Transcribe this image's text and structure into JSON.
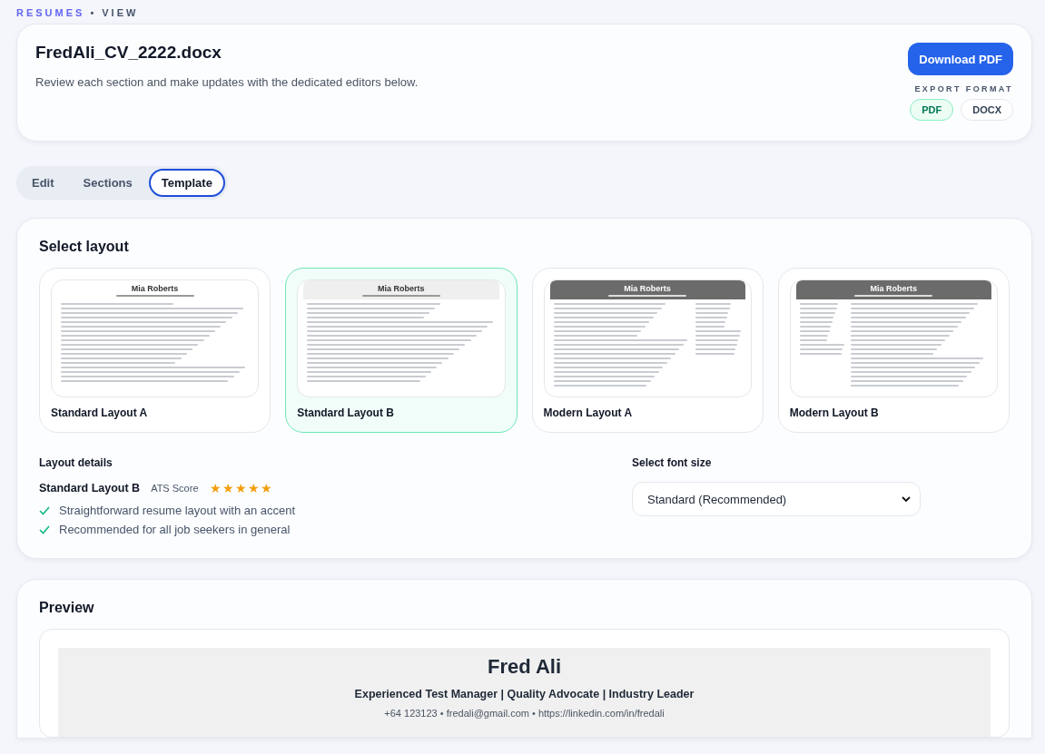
{
  "breadcrumb": {
    "section": "RESUMES",
    "separator": "•",
    "page": "VIEW"
  },
  "header": {
    "title": "FredAli_CV_2222.docx",
    "subtitle": "Review each section and make updates with the dedicated editors below.",
    "download_button": "Download PDF",
    "export_label": "EXPORT FORMAT",
    "formats": [
      {
        "label": "PDF",
        "selected": true
      },
      {
        "label": "DOCX",
        "selected": false
      }
    ]
  },
  "tabs": [
    {
      "label": "Edit",
      "selected": false
    },
    {
      "label": "Sections",
      "selected": false
    },
    {
      "label": "Template",
      "selected": true
    }
  ],
  "select_layout": {
    "title": "Select layout",
    "layouts": [
      {
        "name": "Standard Layout A",
        "kind": "plain",
        "thumb_name": "Mia Roberts",
        "selected": false
      },
      {
        "name": "Standard Layout B",
        "kind": "banded",
        "thumb_name": "Mia Roberts",
        "selected": true
      },
      {
        "name": "Modern Layout A",
        "kind": "sidebar-right",
        "thumb_name": "Mia Roberts",
        "selected": false
      },
      {
        "name": "Modern Layout B",
        "kind": "sidebar-left",
        "thumb_name": "Mia Roberts",
        "selected": false
      }
    ]
  },
  "layout_details": {
    "title": "Layout details",
    "layout_name": "Standard Layout B",
    "score_label": "ATS Score",
    "stars": 5,
    "features": [
      "Straightforward resume layout with an accent",
      "Recommended for all job seekers in general"
    ]
  },
  "font_size": {
    "title": "Select font size",
    "value": "Standard (Recommended)"
  },
  "preview": {
    "title": "Preview",
    "name": "Fred Ali",
    "headline": "Experienced Test Manager | Quality Advocate | Industry Leader",
    "contact": "+64 123123 • fredali@gmail.com • https://linkedin.com/in/fredali"
  }
}
